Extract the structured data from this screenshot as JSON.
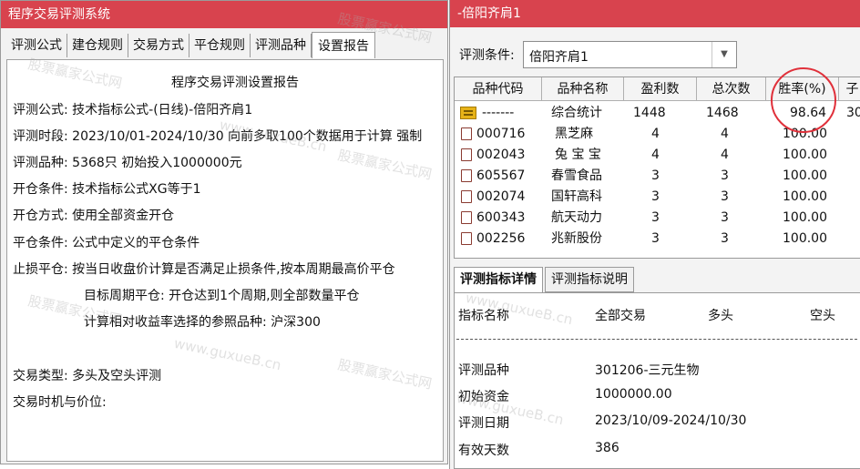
{
  "left_window": {
    "title": "程序交易评测系统",
    "tabs": [
      "评测公式",
      "建仓规则",
      "交易方式",
      "平仓规则",
      "评测品种",
      "设置报告"
    ],
    "active_tab": "设置报告",
    "report": {
      "heading": "程序交易评测设置报告",
      "lines": [
        "评测公式: 技术指标公式-(日线)-倍阳齐肩1",
        "评测时段: 2023/10/01-2024/10/30 向前多取100个数据用于计算 强制",
        "评测品种: 5368只 初始投入1000000元",
        "开仓条件: 技术指标公式XG等于1",
        "开仓方式: 使用全部资金开仓",
        "平仓条件: 公式中定义的平仓条件",
        "止损平仓: 按当日收盘价计算是否满足止损条件,按本周期最高价平仓",
        "目标周期平仓: 开仓达到1个周期,则全部数量平仓",
        "计算相对收益率选择的参照品种: 沪深300",
        "交易类型: 多头及空头评测",
        "交易时机与价位:"
      ]
    }
  },
  "right_window": {
    "title": "-倍阳齐肩1",
    "condition_label": "评测条件:",
    "condition_value": "倍阳齐肩1",
    "grid": {
      "headers": [
        "品种代码",
        "品种名称",
        "盈利数",
        "总次数",
        "胜率(%)",
        "子"
      ],
      "rows": [
        {
          "code": "-------",
          "name": "综合统计",
          "profit": "1448",
          "total": "1468",
          "rate": "98.64",
          "extra": "30"
        },
        {
          "code": "000716",
          "name": "黑芝麻",
          "profit": "4",
          "total": "4",
          "rate": "100.00",
          "extra": ""
        },
        {
          "code": "002043",
          "name": "兔 宝 宝",
          "profit": "4",
          "total": "4",
          "rate": "100.00",
          "extra": ""
        },
        {
          "code": "605567",
          "name": "春雪食品",
          "profit": "3",
          "total": "3",
          "rate": "100.00",
          "extra": ""
        },
        {
          "code": "002074",
          "name": "国轩高科",
          "profit": "3",
          "total": "3",
          "rate": "100.00",
          "extra": ""
        },
        {
          "code": "600343",
          "name": "航天动力",
          "profit": "3",
          "total": "3",
          "rate": "100.00",
          "extra": ""
        },
        {
          "code": "002256",
          "name": "兆新股份",
          "profit": "3",
          "total": "3",
          "rate": "100.00",
          "extra": ""
        }
      ]
    },
    "bottom_tabs": [
      "评测指标详情",
      "评测指标说明"
    ],
    "detail": {
      "headers": [
        "指标名称",
        "全部交易",
        "多头",
        "空头"
      ],
      "rows": [
        {
          "label": "评测品种",
          "value": "301206-三元生物"
        },
        {
          "label": "初始资金",
          "value": "1000000.00"
        },
        {
          "label": "评测日期",
          "value": "2023/10/09-2024/10/30"
        },
        {
          "label": "有效天数",
          "value": "386"
        }
      ]
    }
  },
  "watermark": {
    "cn": "股票赢家公式网",
    "en": "www.guxueB.cn"
  },
  "colors": {
    "titlebar": "#d8434e",
    "highlight_ring": "#e0303a"
  }
}
